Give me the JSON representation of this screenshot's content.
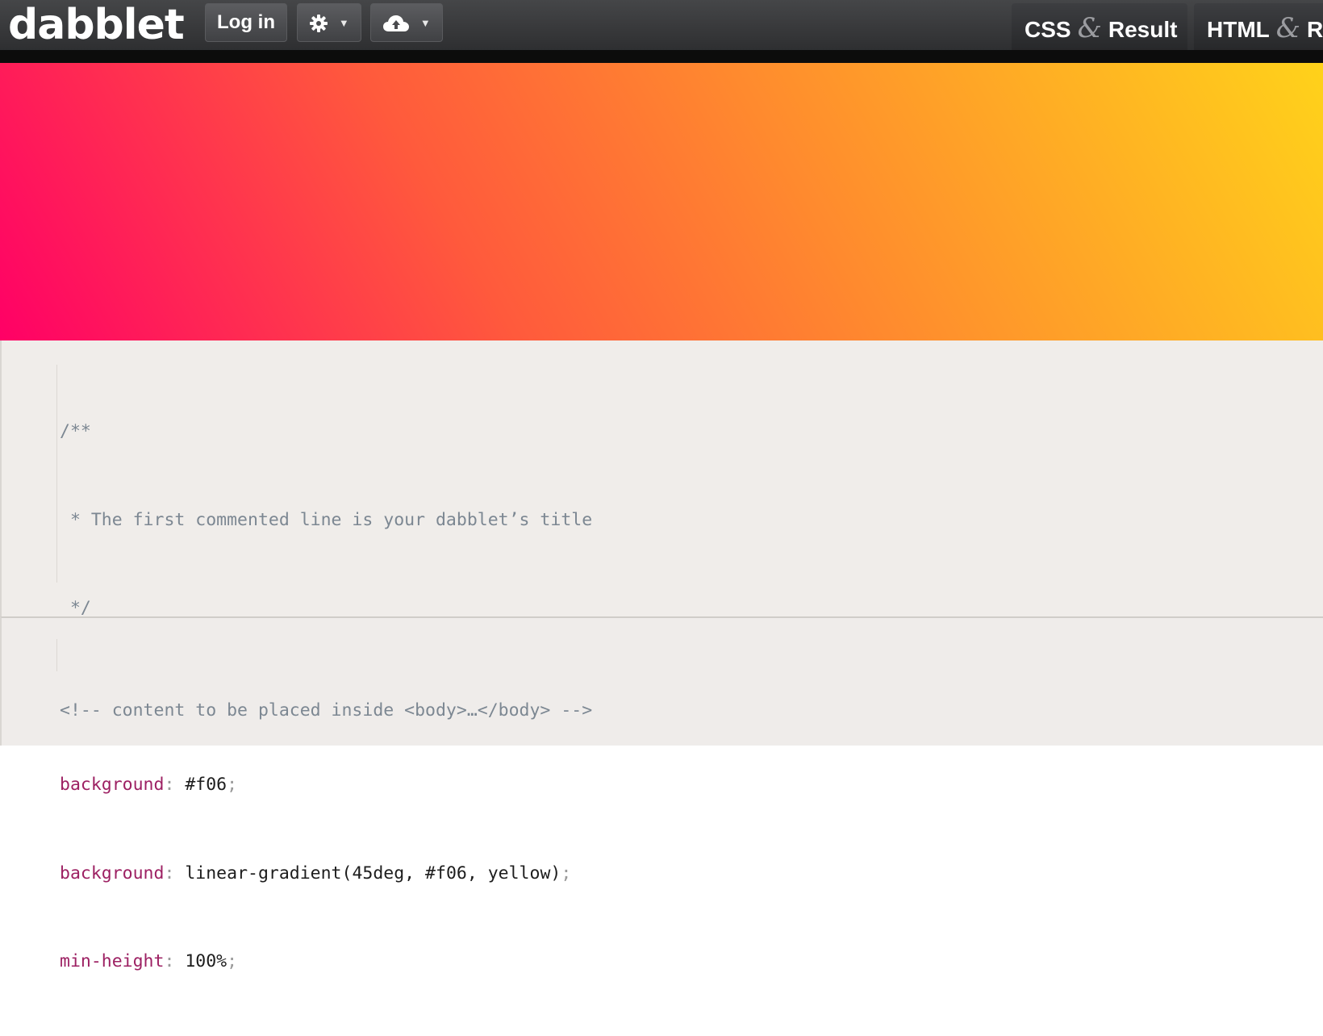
{
  "app": {
    "logo": "dabblet"
  },
  "toolbar": {
    "login_label": "Log in",
    "settings_icon": "gear-icon",
    "cloud_icon": "cloud-upload-icon",
    "caret_icon": "caret-down-icon"
  },
  "views": {
    "tabs": [
      {
        "left": "CSS",
        "amp": "&",
        "right": "Result"
      },
      {
        "left": "HTML",
        "amp": "&",
        "right": "Re"
      }
    ]
  },
  "result": {
    "gradient_colors": [
      "#ff0066",
      "#ffd21a"
    ]
  },
  "css_editor": {
    "comment_lines": [
      "/**",
      " * The first commented line is your dabblet’s title",
      " */"
    ],
    "declarations": [
      {
        "property": "background",
        "value": "#f06"
      },
      {
        "property": "background",
        "value": "linear-gradient(45deg, #f06, yellow)"
      },
      {
        "property": "min-height",
        "value": "100%"
      }
    ]
  },
  "html_editor": {
    "code": "<!-- content to be placed inside <body>…</body> -->"
  },
  "colors": {
    "topbar": "#3a3b3d",
    "editor_bg": "#f0edea",
    "property": "#9d2163",
    "comment": "#7c8792"
  }
}
